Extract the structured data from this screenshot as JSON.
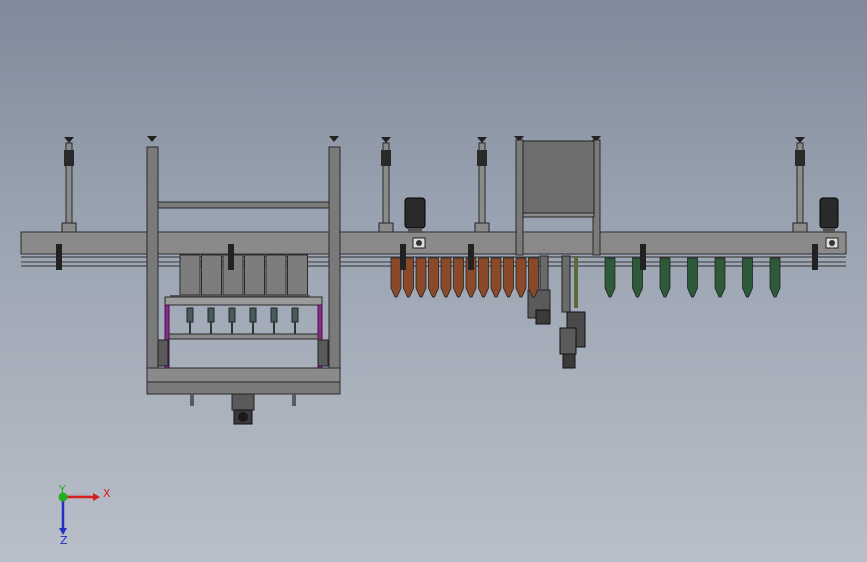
{
  "view": {
    "type": "CAD assembly drawing - filling line (front view)",
    "background": "#9aa3b1"
  },
  "colors": {
    "frame": "#707070",
    "frame_dark": "#3a3a3a",
    "rail": "#8d8d8d",
    "tank": "#7a7a7a",
    "purple_frame": "#8a2a8a",
    "brown_bottles": "#8a4a2a",
    "green_bottles": "#2f5a3a",
    "motor": "#2a2a2a",
    "triad_x": "#d42020",
    "triad_y": "#20b020",
    "triad_z": "#2030c0"
  },
  "triad": {
    "x_label": "X",
    "y_label": "Y",
    "z_label": "Z"
  },
  "counts": {
    "brown_bottles": 12,
    "green_bottles": 7,
    "filling_nozzles": 6
  }
}
